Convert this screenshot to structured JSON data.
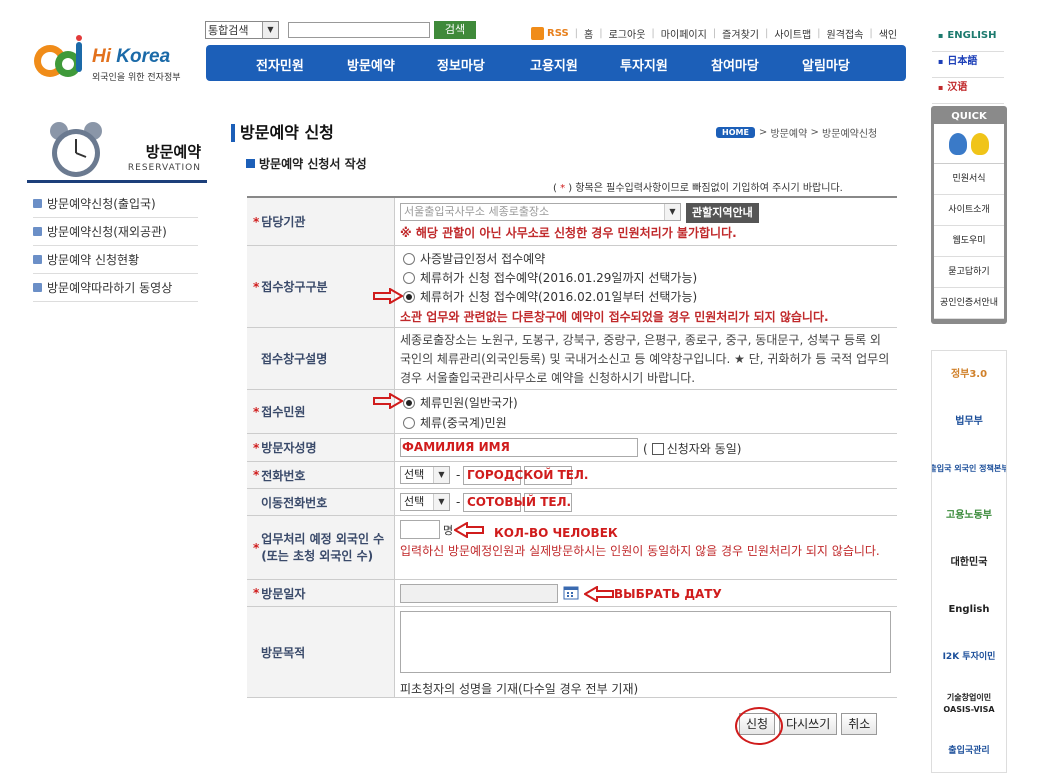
{
  "header": {
    "brand_hi": "Hi",
    "brand_korea": "Korea",
    "tagline": "외국인을 위한 전자정부",
    "search_select": "통합검색",
    "search_button": "검색",
    "util_links": [
      "RSS",
      "홈",
      "로그아웃",
      "마이페이지",
      "즐겨찾기",
      "사이트맵",
      "원격접속",
      "색인"
    ],
    "gnb": [
      "전자민원",
      "방문예약",
      "정보마당",
      "고용지원",
      "투자지원",
      "참여마당",
      "알림마당"
    ],
    "lang": [
      "ENGLISH",
      "日本語",
      "汉语"
    ]
  },
  "quick_menu": {
    "title": "QUICK MENU",
    "items": [
      "민원서식",
      "사이트소개",
      "웹도우미",
      "묻고답하기",
      "공인인증서안내"
    ]
  },
  "banners": [
    "정부3.0",
    "법무부",
    "출입국 외국인 정책본부",
    "고용노동부",
    "대한민국",
    "English",
    "I2K 투자이민",
    "기술창업이민 OASIS-VISA",
    "출입국관리"
  ],
  "lnb": {
    "title": "방문예약",
    "subtitle": "RESERVATION",
    "items": [
      "방문예약신청(출입국)",
      "방문예약신청(재외공관)",
      "방문예약 신청현황",
      "방문예약따라하기 동영상"
    ]
  },
  "content": {
    "page_title": "방문예약 신청",
    "breadcrumb_home": "HOME",
    "breadcrumb": [
      "방문예약",
      "방문예약신청"
    ],
    "sub_title": "방문예약 신청서 작성",
    "req_note_pre": "(",
    "req_note_star": "*",
    "req_note_post": ") 항목은 필수입력사항이므로 빠짐없이 기입하여 주시기 바랍니다."
  },
  "form": {
    "office": {
      "label": "담당기관",
      "value": "서울출입국사무소 세종로출장소",
      "button": "관할지역안내",
      "warning": "※ 해당 관할이 아닌 사무소로 신청한 경우 민원처리가 불가합니다."
    },
    "counter": {
      "label": "접수창구구분",
      "options": [
        "사증발급인정서 접수예약",
        "체류허가 신청 접수예약(2016.01.29일까지 선택가능)",
        "체류허가 신청 접수예약(2016.02.01일부터 선택가능)"
      ],
      "warning": "소관 업무와 관련없는 다른창구에 예약이 접수되었을 경우 민원처리가 되지 않습니다."
    },
    "counter_desc": {
      "label": "접수창구설명",
      "text": "세종로출장소는 노원구, 도봉구, 강북구, 중랑구, 은평구, 종로구, 중구, 동대문구, 성북구 등록 외국인의 체류관리(외국인등록) 및 국내거소신고 등 예약창구입니다. ★ 단, 귀화허가 등 국적 업무의 경우 서울출입국관리사무소로 예약을 신청하시기 바랍니다."
    },
    "service": {
      "label": "접수민원",
      "options": [
        "체류민원(일반국가)",
        "체류(중국계)민원"
      ]
    },
    "name": {
      "label": "방문자성명",
      "value": "ФАМИЛИЯ ИМЯ",
      "same_prefix": "(",
      "same_label": "신청자와 동일)"
    },
    "phone": {
      "label": "전화번호",
      "select": "선택",
      "dash": "-",
      "note": "ГОРОДСКОЙ ТЕЛ."
    },
    "mobile": {
      "label": "이동전화번호",
      "select": "선택",
      "dash": "-",
      "note": "СОТОВЫЙ ТЕЛ."
    },
    "count": {
      "label_line1": "업무처리 예정 외국인 수",
      "label_line2": "(또는 초청 외국인 수)",
      "unit": "명",
      "note": "КОЛ-ВО ЧЕЛОВЕК",
      "warning": "입력하신 방문예정인원과 실제방문하시는 인원이 동일하지 않을 경우 민원처리가 되지 않습니다."
    },
    "date": {
      "label": "방문일자",
      "note": "ВЫБРАТЬ ДАТУ"
    },
    "purpose": {
      "label": "방문목적",
      "hint": "피초청자의 성명을 기재(다수일 경우 전부 기재)"
    }
  },
  "buttons": {
    "submit": "신청",
    "reset": "다시쓰기",
    "cancel": "취소"
  },
  "colors": {
    "gnb": "#1c5fb8",
    "annotation_red": "#d01c1c"
  }
}
